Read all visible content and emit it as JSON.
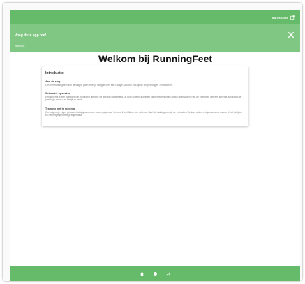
{
  "header": {
    "signin_label": "INLOGGEN",
    "signin_icon": "external-link-icon"
  },
  "install_banner": {
    "title": "Voeg deze app toe!",
    "subtitle": "Web bro..",
    "close_icon": "close-icon"
  },
  "main": {
    "title": "Welkom bij RunningFeet"
  },
  "intro_card": {
    "title": "Introductie",
    "sections": [
      {
        "heading": "Aan de slag",
        "body": "Om met RunningFeet aan de slag te gaan moet je inloggen met een Google Account. Klik op de knop 'Inloggen' rechtsboven."
      },
      {
        "heading": "Schema's opzoeken",
        "body": "Een schema is een overzicht van trainingen die door de app zijn vastgesteld. Je kunt schema's openen via het overzicht en ze zijn opgeslagen. Pas de trainingen van een schema aan zodat het past bij je niveau, en bekijk ze eerst."
      },
      {
        "heading": "Training met je schema",
        "body": "Om volgens je eigen gekozen training schema te lopen ga je naar 'schema's' en klik op een schema. Start de training en volg de instructies. Je kunt ook een eigen schema maken of het bekijken en het vergelijken met je eigen data."
      }
    ]
  },
  "bottom_nav": {
    "items": [
      {
        "name": "home",
        "icon": "home-icon"
      },
      {
        "name": "running",
        "icon": "circle-icon"
      },
      {
        "name": "share",
        "icon": "share-arrow-icon"
      }
    ]
  },
  "colors": {
    "primary": "#66bb6a",
    "banner": "#81c784"
  }
}
